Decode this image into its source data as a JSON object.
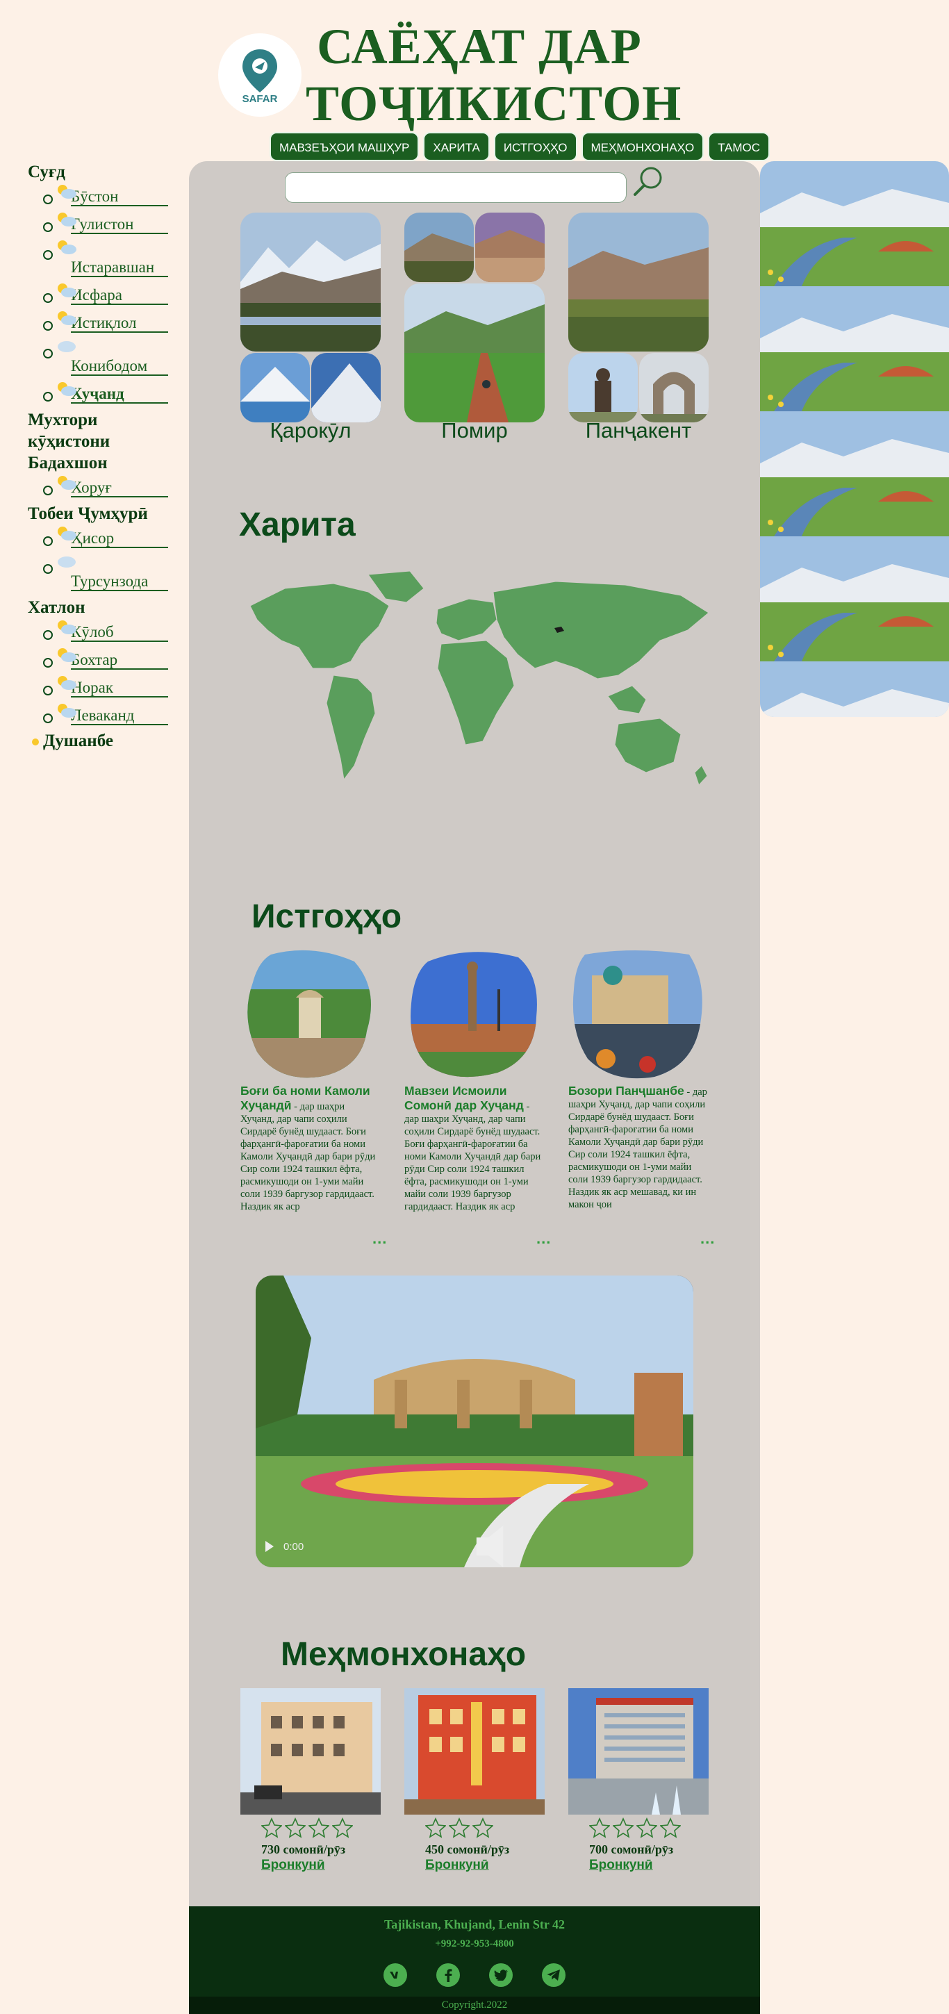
{
  "header": {
    "logo_text": "SAFAR",
    "title_line1": "САЁҲАТ ДАР",
    "title_line2": "ТОҶИКИСТОН"
  },
  "nav": [
    {
      "label": "МАВЗЕЪҲОИ МАШҲУР",
      "name": "nav-famous-places"
    },
    {
      "label": "ХАРИТА",
      "name": "nav-map"
    },
    {
      "label": "ИСТГОҲҲО",
      "name": "nav-attractions"
    },
    {
      "label": "МЕҲМОНХОНАҲО",
      "name": "nav-hotels"
    },
    {
      "label": "ТАМОС",
      "name": "nav-contact"
    }
  ],
  "sidebar": {
    "regions": [
      {
        "name": "Суғд",
        "cities": [
          {
            "name": "Бӯстон",
            "weather": "sun-cloud-icon"
          },
          {
            "name": "Гулистон",
            "weather": "sun-cloud-icon"
          },
          {
            "name": "Истаравшан",
            "weather": "sun-cloud-icon",
            "wrap": true
          },
          {
            "name": "Исфара",
            "weather": "sun-cloud-icon"
          },
          {
            "name": "Истиқлол",
            "weather": "sun-cloud-icon"
          },
          {
            "name": "Конибодом",
            "weather": "cloud-icon",
            "wrap": true
          },
          {
            "name": "Хуҷанд",
            "weather": "sun-cloud-icon",
            "active": true
          }
        ]
      },
      {
        "name": "Мухтори кӯҳистони Бадахшон",
        "cities": [
          {
            "name": "Хоруғ",
            "weather": "sun-cloud-icon"
          }
        ]
      },
      {
        "name": "Тобеи Ҷумҳурӣ",
        "cities": [
          {
            "name": "Ҳисор",
            "weather": "sun-cloud-icon"
          },
          {
            "name": "Турсунзода",
            "weather": "cloud-icon",
            "wrap": true
          }
        ]
      },
      {
        "name": "Хатлон",
        "cities": [
          {
            "name": "Кӯлоб",
            "weather": "sun-cloud-icon"
          },
          {
            "name": "Бохтар",
            "weather": "sun-cloud-icon"
          },
          {
            "name": "Норак",
            "weather": "sun-cloud-icon"
          },
          {
            "name": "Леваканд",
            "weather": "sun-cloud-icon"
          }
        ]
      }
    ],
    "capital": "Душанбе"
  },
  "search": {
    "placeholder": "",
    "value": ""
  },
  "galleries": [
    {
      "label": "Қарокӯл"
    },
    {
      "label": "Помир"
    },
    {
      "label": "Панҷакент"
    }
  ],
  "map_section": {
    "title": "Харита"
  },
  "attractions_section": {
    "title": "Истгоҳҳо"
  },
  "attractions": [
    {
      "title": "Боғи ба номи Камоли Хуҷандӣ",
      "text": " - дар шаҳри Хуҷанд, дар чапи соҳили Сирдарё бунёд шудааст. Боғи фарҳангӣ-фароғатии ба номи Камоли Хуҷандӣ дар бари рӯди Сир соли 1924 ташкил ёфта, расмикушоди он 1-уми майи соли 1939 баргузор гардидааст. Наздик як аср",
      "more": "..."
    },
    {
      "title": "Мавзеи Исмоили Сомонӣ дар Хуҷанд",
      "text": " - дар шаҳри Хуҷанд, дар чапи соҳили Сирдарё бунёд шудааст. Боғи фарҳангӣ-фароғатии ба номи Камоли Хуҷандӣ дар бари рӯди Сир соли 1924 ташкил ёфта, расмикушоди он 1-уми майи соли 1939 баргузор гардидааст. Наздик як аср",
      "more": "..."
    },
    {
      "title": "Бозори Панҷшанбе",
      "text": " - дар шаҳри Хуҷанд, дар чапи соҳили Сирдарё бунёд шудааст. Боғи фарҳангӣ-фароғатии ба номи Камоли Хуҷандӣ дар бари рӯди Сир соли 1924 ташкил ёфта, расмикушоди он 1-уми майи соли 1939 баргузор гардидааст. Наздик як аср мешавад, ки ин макон ҷои",
      "more": "..."
    }
  ],
  "video": {
    "time": "0:00"
  },
  "hotels_section": {
    "title": "Меҳмонхонаҳо"
  },
  "hotels": [
    {
      "price": "730 сомонӣ/рӯз",
      "book": "Бронкунӣ",
      "rating": 0
    },
    {
      "price": "450 сомонӣ/рӯз",
      "book": "Бронкунӣ",
      "rating": 0
    },
    {
      "price": "700 сомонӣ/рӯз",
      "book": "Бронкунӣ",
      "rating": 0
    }
  ],
  "footer": {
    "address": "Tajikistan, Khujand, Lenin Str 42",
    "phone": "+992-92-953-4800",
    "social": [
      "vk-icon",
      "facebook-icon",
      "twitter-icon",
      "telegram-icon"
    ],
    "copyright": "Copyright.2022"
  },
  "colors": {
    "brand": "#1b5e20",
    "panel": "#cfcac6",
    "background": "#fdf1e7",
    "footer": "#0a2e10",
    "link": "#1b7d2a"
  }
}
